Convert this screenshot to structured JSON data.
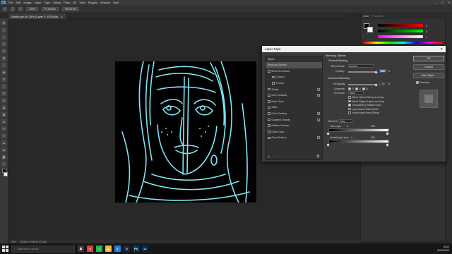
{
  "app": {
    "logo": "Ps",
    "menu": [
      "File",
      "Edit",
      "Image",
      "Layer",
      "Type",
      "Select",
      "Filter",
      "3D",
      "View",
      "Plugins",
      "Window",
      "Help"
    ],
    "window_controls": [
      "—",
      "▢",
      "✕"
    ]
  },
  "options_bar": {
    "zoom_value": "100%",
    "fit_screen": "Fit Screen",
    "fill_screen": "Fill Screen"
  },
  "document": {
    "tab_title": "Walfel.psd @ 25% (Layer 0, RGB/8#)",
    "close": "×"
  },
  "status": {
    "zoom": "25%",
    "info": "2048 px x 2048 px (72 ppi)"
  },
  "right_panel": {
    "tab_active": "Color",
    "tab_inactive": "Properties",
    "slider_values": [
      "0",
      "0",
      "0",
      "0"
    ]
  },
  "dialog": {
    "title": "Layer Style",
    "close": "✕",
    "styles_header": "Styles",
    "styles": [
      {
        "label": "Blending Options",
        "selected": true,
        "checkbox": false,
        "plus": false,
        "indent": false
      },
      {
        "label": "Bevel & Emboss",
        "selected": false,
        "checkbox": true,
        "plus": false,
        "indent": false
      },
      {
        "label": "Contour",
        "selected": false,
        "checkbox": true,
        "plus": false,
        "indent": true
      },
      {
        "label": "Texture",
        "selected": false,
        "checkbox": true,
        "plus": false,
        "indent": true
      },
      {
        "label": "Stroke",
        "selected": false,
        "checkbox": true,
        "plus": true,
        "indent": false
      },
      {
        "label": "Inner Shadow",
        "selected": false,
        "checkbox": true,
        "plus": true,
        "indent": false
      },
      {
        "label": "Inner Glow",
        "selected": false,
        "checkbox": true,
        "plus": false,
        "indent": false
      },
      {
        "label": "Satin",
        "selected": false,
        "checkbox": true,
        "plus": false,
        "indent": false
      },
      {
        "label": "Color Overlay",
        "selected": false,
        "checkbox": true,
        "plus": true,
        "indent": false
      },
      {
        "label": "Gradient Overlay",
        "selected": false,
        "checkbox": true,
        "plus": true,
        "indent": false
      },
      {
        "label": "Pattern Overlay",
        "selected": false,
        "checkbox": true,
        "plus": false,
        "indent": false
      },
      {
        "label": "Outer Glow",
        "selected": false,
        "checkbox": true,
        "plus": false,
        "indent": false
      },
      {
        "label": "Drop Shadow",
        "selected": false,
        "checkbox": true,
        "plus": true,
        "indent": false
      }
    ],
    "footer_icons": [
      "fx",
      "↑",
      "↓",
      "🗑"
    ],
    "blending": {
      "section": "Blending Options",
      "general": "General Blending",
      "blend_mode_label": "Blend Mode:",
      "blend_mode_value": "Normal",
      "opacity_label": "Opacity:",
      "opacity_value": "100",
      "percent": "%",
      "advanced": "Advanced Blending",
      "fill_opacity_label": "Fill Opacity:",
      "fill_opacity_value": "100",
      "channels_label": "Channels:",
      "channels": [
        "R",
        "G",
        "B"
      ],
      "knockout_label": "Knockout:",
      "knockout_value": "None",
      "checks": [
        {
          "label": "Blend Interior Effects as Group",
          "on": false
        },
        {
          "label": "Blend Clipped Layers as Group",
          "on": true
        },
        {
          "label": "Transparency Shapes Layer",
          "on": true
        },
        {
          "label": "Layer Mask Hides Effects",
          "on": false
        },
        {
          "label": "Vector Mask Hides Effects",
          "on": false
        }
      ],
      "blend_if_label": "Blend If:",
      "blend_if_value": "Gray",
      "this_layer_label": "This Layer:",
      "this_layer_low": "0",
      "this_layer_high": "255",
      "underlying_label": "Underlying Layer:",
      "underlying_low": "0",
      "underlying_high": "255"
    },
    "buttons": {
      "ok": "OK",
      "cancel": "Cancel",
      "new_style": "New Style...",
      "preview": "Preview"
    }
  },
  "taskbar": {
    "search_placeholder": "Type here to search",
    "apps": [
      {
        "name": "task-view",
        "glyph": "⧉",
        "color": "#3a3a3a"
      },
      {
        "name": "chrome",
        "glyph": "●",
        "color": "#db4437"
      },
      {
        "name": "spotify",
        "glyph": "♫",
        "color": "#1db954"
      },
      {
        "name": "explorer",
        "glyph": "▬",
        "color": "#f3b33d"
      },
      {
        "name": "edge",
        "glyph": "e",
        "color": "#2b7bd6"
      },
      {
        "name": "steam",
        "glyph": "S",
        "color": "#1b2838"
      },
      {
        "name": "photoshop",
        "glyph": "Ps",
        "color": "#0a3a5a"
      },
      {
        "name": "lightroom",
        "glyph": "Lr",
        "color": "#0a2a4a"
      }
    ],
    "time": "18:03",
    "date": "26/06/2023"
  },
  "colors": {
    "accent": "#31a8ff",
    "line_art": "#7ee8f6"
  }
}
